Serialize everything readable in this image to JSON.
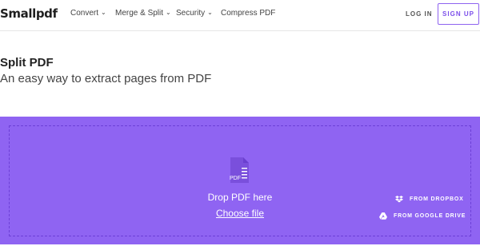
{
  "header": {
    "logo": "Smallpdf",
    "nav": [
      {
        "label": "Convert",
        "has_dropdown": true
      },
      {
        "label": "Merge & Split",
        "has_dropdown": true
      },
      {
        "label": "Security",
        "has_dropdown": true
      },
      {
        "label": "Compress PDF",
        "has_dropdown": false
      }
    ],
    "login_label": "LOG IN",
    "signup_label": "SIGN UP",
    "accent_color": "#8e63f0"
  },
  "page": {
    "title": "Split PDF",
    "subtitle": "An easy way to extract pages from PDF"
  },
  "dropzone": {
    "background_color": "#8f64f2",
    "icon": "pdf-file-icon",
    "icon_label": "PDF",
    "drop_text": "Drop PDF here",
    "choose_label": "Choose file",
    "dropbox_label": "FROM DROPBOX",
    "gdrive_label": "FROM GOOGLE DRIVE"
  }
}
